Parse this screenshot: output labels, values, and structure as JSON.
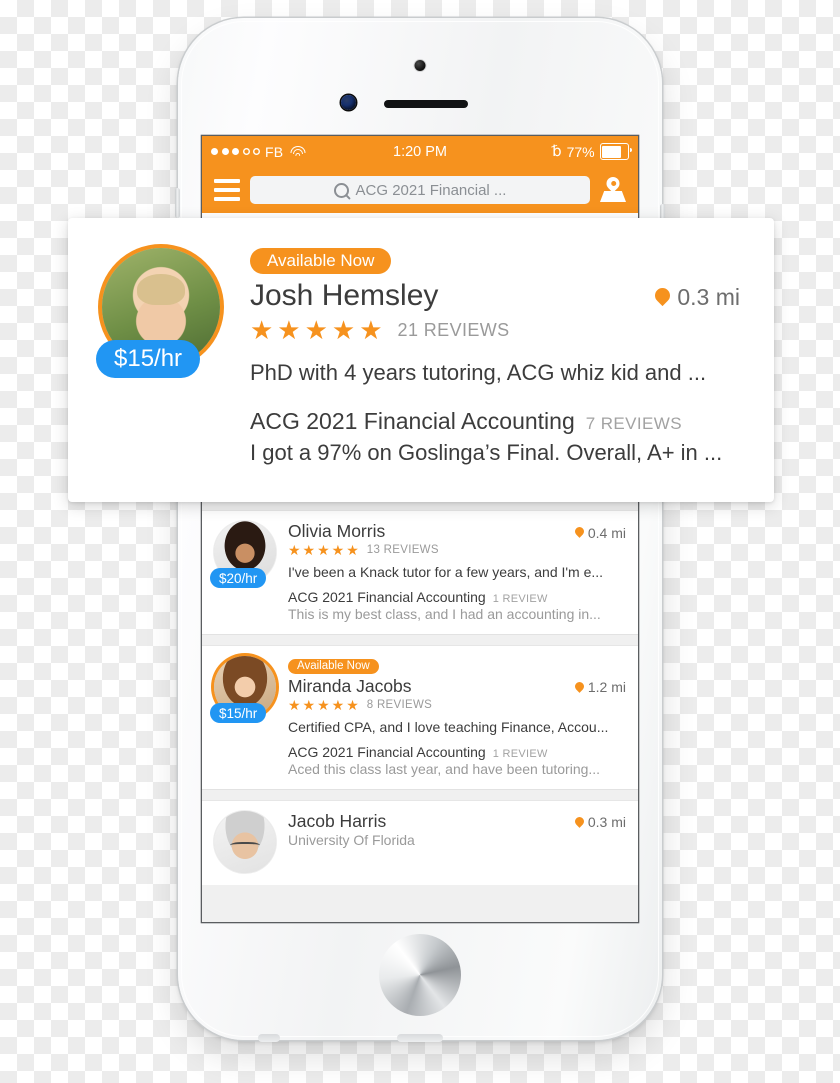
{
  "status_bar": {
    "carrier": "FB",
    "signal_filled": 3,
    "signal_total": 5,
    "time": "1:20 PM",
    "bluetooth_icon": "bluetooth-icon",
    "battery_percent": "77%",
    "battery_level": 77
  },
  "nav": {
    "menu_icon": "hamburger-menu-icon",
    "search_value": "ACG 2021 Financial ...",
    "search_icon": "search-icon",
    "map_icon": "map-pin-icon"
  },
  "featured": {
    "badge": "Available Now",
    "name": "Josh Hemsley",
    "price": "$15/hr",
    "distance": "0.3 mi",
    "distance_icon": "location-pin-icon",
    "stars": "★★★★★",
    "rating": 5,
    "reviews": "21 REVIEWS",
    "blurb": "PhD with 4 years tutoring, ACG whiz kid and ...",
    "course": "ACG 2021 Financial Accounting",
    "course_reviews": "7 REVIEWS",
    "quote": "I got a 97% on Goslinga’s Final. Overall, A+ in ...",
    "avatar": "tutor-avatar-josh"
  },
  "list": [
    {
      "badge": null,
      "name": "Olivia Morris",
      "university": null,
      "price": "$20/hr",
      "distance": "0.4 mi",
      "stars": "★★★★★",
      "rating": 5,
      "reviews": "13 REVIEWS",
      "blurb": "I've been a Knack tutor for a few years, and I'm e...",
      "course": "ACG 2021 Financial Accounting",
      "course_reviews": "1 REVIEW",
      "quote": "This is my best class, and I had an accounting in...",
      "avatar": "tutor-avatar-olivia"
    },
    {
      "badge": "Available Now",
      "name": "Miranda Jacobs",
      "university": null,
      "price": "$15/hr",
      "distance": "1.2 mi",
      "stars": "★★★★★",
      "rating": 5,
      "reviews": "8 REVIEWS",
      "blurb": "Certified CPA, and I love teaching Finance, Accou...",
      "course": "ACG 2021 Financial Accounting",
      "course_reviews": "1 REVIEW",
      "quote": "Aced this class last year, and have been tutoring...",
      "avatar": "tutor-avatar-miranda"
    },
    {
      "badge": null,
      "name": "Jacob Harris",
      "university": "University Of Florida",
      "price": null,
      "distance": "0.3 mi",
      "stars": null,
      "rating": null,
      "reviews": null,
      "blurb": null,
      "course": null,
      "course_reviews": null,
      "quote": null,
      "avatar": "tutor-avatar-jacob"
    }
  ],
  "colors": {
    "brand_orange": "#F6921E",
    "price_blue": "#2196F3",
    "text_dark": "#3c3c3c",
    "text_muted": "#9a9a9a"
  }
}
